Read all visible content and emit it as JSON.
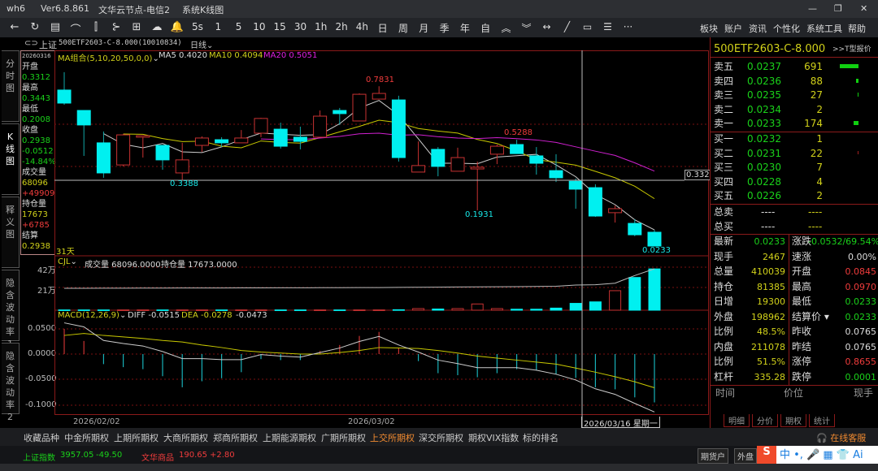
{
  "window": {
    "app": "wh6",
    "version": "Ver6.8.861",
    "server": "文华云节点-电信2",
    "view": "系统K线图",
    "minimize": "—",
    "maximize": "❐",
    "close": "✕"
  },
  "toolbar": {
    "icons": [
      {
        "name": "back-icon",
        "glyph": "←"
      },
      {
        "name": "refresh-icon",
        "glyph": "↻"
      },
      {
        "name": "table-icon",
        "glyph": "▤"
      },
      {
        "name": "line-chart-icon",
        "glyph": "⌒"
      },
      {
        "name": "candle-icon",
        "glyph": "⫿"
      },
      {
        "name": "split-icon",
        "glyph": "⊱"
      },
      {
        "name": "panel-icon",
        "glyph": "⊞"
      },
      {
        "name": "cloud-icon",
        "glyph": "☁"
      },
      {
        "name": "bell-icon",
        "glyph": "🔔"
      }
    ],
    "periods": [
      "5s",
      "1",
      "5",
      "10",
      "15",
      "30",
      "1h",
      "2h",
      "4h",
      "日",
      "周",
      "月",
      "季",
      "年",
      "自"
    ],
    "tools": [
      {
        "name": "chevrons-up-icon",
        "glyph": "︽"
      },
      {
        "name": "chevrons-down-icon",
        "glyph": "︾"
      },
      {
        "name": "expand-icon",
        "glyph": "↔"
      },
      {
        "name": "draw-line-icon",
        "glyph": "╱"
      },
      {
        "name": "rectangle-icon",
        "glyph": "▭"
      },
      {
        "name": "list-icon",
        "glyph": "☰"
      },
      {
        "name": "more-icon",
        "glyph": "···"
      }
    ],
    "menus": [
      "板块",
      "账户",
      "资讯",
      "个性化",
      "系统工具",
      "帮助"
    ]
  },
  "symbol": {
    "exchange": "上证",
    "name": "500ETF2603-C-8.000(10010834)",
    "period": "日线"
  },
  "left_tabs": [
    "分时图",
    "K线图",
    "释义图",
    "隐含波动率1",
    "隐含波动率2"
  ],
  "info": {
    "date": "20260316",
    "open_label": "开盘",
    "open": "0.3312",
    "high_label": "最高",
    "high": "0.3443",
    "low_label": "最低",
    "low": "0.2008",
    "close_label": "收盘",
    "close": "0.2938",
    "change": "-0.0512",
    "change_pct": "-14.84%",
    "volume_label": "成交量",
    "volume": "68096",
    "volume_change": "+49909",
    "oi_label": "持仓量",
    "oi": "17673",
    "oi_change": "+6785",
    "settle_label": "结算",
    "settle": "0.2938"
  },
  "price_panel": {
    "legend": "MA组合(5,10,20,50,0,0)",
    "ma5": "MA5 0.4020",
    "ma10": "MA10 0.4094",
    "ma20": "MA20 0.5051",
    "days": "31天",
    "annotations": {
      "max": "0.7831",
      "min": "0.3388",
      "low2": "0.1931",
      "high2": "0.5288",
      "last": "0.0233"
    },
    "crosshair_price": "0.3321"
  },
  "volume_panel": {
    "legend": "CJL",
    "vol_text": "成交量 68096.0000",
    "oi_text": "持仓量 17673.0000",
    "ticks": [
      "42万",
      "21万"
    ]
  },
  "macd_panel": {
    "legend": "MACD(12,26,9)",
    "diff": "DIFF -0.0515",
    "dea": "DEA -0.0278",
    "macd": "-0.0473",
    "ticks": [
      "0.0500",
      "0.0000",
      "-0.0500",
      "-0.1000"
    ]
  },
  "date_axis": {
    "labels": [
      "2026/02/02",
      "2026/03/02"
    ],
    "crosshair_date": "2026/03/16 星期一"
  },
  "colors": {
    "up": "#c83232",
    "down": "#00f0f0",
    "ma5": "#cccccc",
    "ma10": "#c8c800",
    "ma20": "#d020d0",
    "grid": "#7a1010"
  },
  "chart_data": {
    "type": "candlestick",
    "ohlc": [
      [
        0.765,
        0.85,
        0.695,
        0.703
      ],
      [
        0.668,
        0.668,
        0.452,
        0.599
      ],
      [
        0.514,
        0.568,
        0.348,
        0.371
      ],
      [
        0.409,
        0.556,
        0.402,
        0.552
      ],
      [
        0.541,
        0.548,
        0.444,
        0.548
      ],
      [
        0.502,
        0.502,
        0.386,
        0.433
      ],
      [
        0.371,
        0.514,
        0.3388,
        0.433
      ],
      [
        0.502,
        0.545,
        0.471,
        0.537
      ],
      [
        0.529,
        0.541,
        0.494,
        0.514
      ],
      [
        0.514,
        0.575,
        0.514,
        0.537
      ],
      [
        0.56,
        0.633,
        0.541,
        0.63
      ],
      [
        0.579,
        0.61,
        0.487,
        0.498
      ],
      [
        0.541,
        0.591,
        0.483,
        0.521
      ],
      [
        0.541,
        0.668,
        0.541,
        0.641
      ],
      [
        0.668,
        0.68,
        0.599,
        0.653
      ],
      [
        0.618,
        0.749,
        0.618,
        0.745
      ],
      [
        0.722,
        0.7831,
        0.722,
        0.749
      ],
      [
        0.718,
        0.738,
        0.425,
        0.444
      ],
      [
        0.375,
        0.521,
        0.375,
        0.406
      ],
      [
        0.483,
        0.494,
        0.355,
        0.402
      ],
      [
        0.379,
        0.491,
        0.379,
        0.444
      ],
      [
        0.39,
        0.425,
        0.1931,
        0.398
      ],
      [
        0.46,
        0.506,
        0.413,
        0.498
      ],
      [
        0.506,
        0.5288,
        0.463,
        0.463
      ],
      [
        0.452,
        0.494,
        0.363,
        0.417
      ],
      [
        0.382,
        0.46,
        0.328,
        0.348
      ],
      [
        0.3312,
        0.3443,
        0.2008,
        0.2938
      ],
      [
        0.301,
        0.317,
        0.162,
        0.166
      ],
      [
        0.182,
        0.216,
        0.135,
        0.201
      ],
      [
        0.131,
        0.151,
        0.07,
        0.077
      ],
      [
        0.089,
        0.1,
        0.0233,
        0.0233
      ]
    ],
    "volume": [
      3000,
      3000,
      3000,
      3000,
      3000,
      3000,
      3000,
      3000,
      3000,
      3000,
      3000,
      3000,
      3000,
      3000,
      3000,
      3000,
      3000,
      5000,
      16000,
      12000,
      16000,
      62000,
      16000,
      10000,
      10000,
      21000,
      68096,
      83000,
      194000,
      325000,
      410039
    ],
    "open_interest": [
      5000,
      5000,
      5200,
      5400,
      5600,
      5800,
      6000,
      6200,
      6300,
      6500,
      6700,
      6900,
      7000,
      7200,
      7400,
      7600,
      7800,
      8500,
      9000,
      9500,
      10000,
      10500,
      11000,
      11500,
      12000,
      13000,
      17673,
      19000,
      25000,
      55000,
      81385
    ],
    "diff": [
      0.062,
      0.054,
      0.027,
      0.021,
      0.016,
      0.005,
      -0.009,
      -0.009,
      -0.011,
      -0.011,
      -0.001,
      -0.004,
      -0.006,
      0.003,
      0.012,
      0.025,
      0.035,
      0.018,
      0.004,
      -0.012,
      -0.019,
      -0.027,
      -0.027,
      -0.027,
      -0.032,
      -0.04,
      -0.0515,
      -0.069,
      -0.08,
      -0.098,
      -0.115
    ],
    "dea": [
      0.037,
      0.041,
      0.037,
      0.034,
      0.031,
      0.027,
      0.024,
      0.018,
      0.013,
      0.007,
      0.004,
      0.002,
      0.0,
      0.0,
      0.003,
      0.007,
      0.013,
      0.012,
      0.011,
      0.007,
      0.002,
      -0.004,
      -0.008,
      -0.012,
      -0.016,
      -0.02,
      -0.0278,
      -0.036,
      -0.045,
      -0.055,
      -0.067
    ],
    "macd_ylim": [
      -0.1,
      0.05
    ],
    "volume_ylim": [
      0,
      420000
    ]
  },
  "quote": {
    "title": "500ETF2603-C-8.000",
    "t_link": ">>T型报价",
    "asks": [
      {
        "label": "卖五",
        "price": "0.0237",
        "vol": "691",
        "bar": 1
      },
      {
        "label": "卖四",
        "price": "0.0236",
        "vol": "88",
        "bar": 0.13
      },
      {
        "label": "卖三",
        "price": "0.0235",
        "vol": "27",
        "bar": 0.04
      },
      {
        "label": "卖二",
        "price": "0.0234",
        "vol": "2",
        "bar": 0
      },
      {
        "label": "卖一",
        "price": "0.0233",
        "vol": "174",
        "bar": 0.25
      }
    ],
    "bids": [
      {
        "label": "买一",
        "price": "0.0232",
        "vol": "1",
        "bar": 0
      },
      {
        "label": "买二",
        "price": "0.0231",
        "vol": "22",
        "bar": 0.03
      },
      {
        "label": "买三",
        "price": "0.0230",
        "vol": "7",
        "bar": 0
      },
      {
        "label": "买四",
        "price": "0.0228",
        "vol": "4",
        "bar": 0
      },
      {
        "label": "买五",
        "price": "0.0226",
        "vol": "2",
        "bar": 0
      }
    ],
    "totals": [
      {
        "label": "总卖",
        "a": "----",
        "b": "----"
      },
      {
        "label": "总买",
        "a": "----",
        "b": "----"
      }
    ],
    "stats": [
      {
        "l1": "最新",
        "v1": "0.0233",
        "c1": "g",
        "l2": "涨跌",
        "v2": "-0.0532/69.54%",
        "c2": "g"
      },
      {
        "l1": "现手",
        "v1": "2467",
        "c1": "y",
        "l2": "速涨",
        "v2": "0.00%",
        "c2": "w"
      },
      {
        "l1": "总量",
        "v1": "410039",
        "c1": "y",
        "l2": "开盘",
        "v2": "0.0845",
        "c2": "r"
      },
      {
        "l1": "持仓",
        "v1": "81385",
        "c1": "y",
        "l2": "最高",
        "v2": "0.0970",
        "c2": "r"
      },
      {
        "l1": "日增",
        "v1": "19300",
        "c1": "y",
        "l2": "最低",
        "v2": "0.0233",
        "c2": "g"
      },
      {
        "l1": "外盘",
        "v1": "198962",
        "c1": "y",
        "l2": "结算价 ▾",
        "v2": "0.0233",
        "c2": "g"
      },
      {
        "l1": "比例",
        "v1": "48.5%",
        "c1": "y",
        "l2": "昨收",
        "v2": "0.0765",
        "c2": "w"
      },
      {
        "l1": "内盘",
        "v1": "211078",
        "c1": "y",
        "l2": "昨结",
        "v2": "0.0765",
        "c2": "w"
      },
      {
        "l1": "比例",
        "v1": "51.5%",
        "c1": "y",
        "l2": "涨停",
        "v2": "0.8655",
        "c2": "r"
      },
      {
        "l1": "杠杆",
        "v1": "335.28",
        "c1": "y",
        "l2": "跌停",
        "v2": "0.0001",
        "c2": "g"
      }
    ],
    "tick_header": [
      "时间",
      "价位",
      "现手"
    ],
    "tabs": [
      "明细",
      "分价",
      "期权",
      "统计"
    ]
  },
  "bottom_tabs": {
    "items": [
      "收藏品种",
      "中金所期权",
      "上期所期权",
      "大商所期权",
      "郑商所期权",
      "上期能源期权",
      "广期所期权",
      "上交所期权",
      "深交所期权",
      "期权VIX指数",
      "标的排名"
    ],
    "active": 7,
    "service": "在线客服"
  },
  "index_bar": {
    "idx1": "上证指数",
    "idx1_val": "3957.05",
    "idx1_chg": "-49.50",
    "idx2": "文华商品",
    "idx2_val": "190.65",
    "idx2_chg": "+2.80",
    "btn1": "期货户",
    "btn2": "外盘"
  }
}
